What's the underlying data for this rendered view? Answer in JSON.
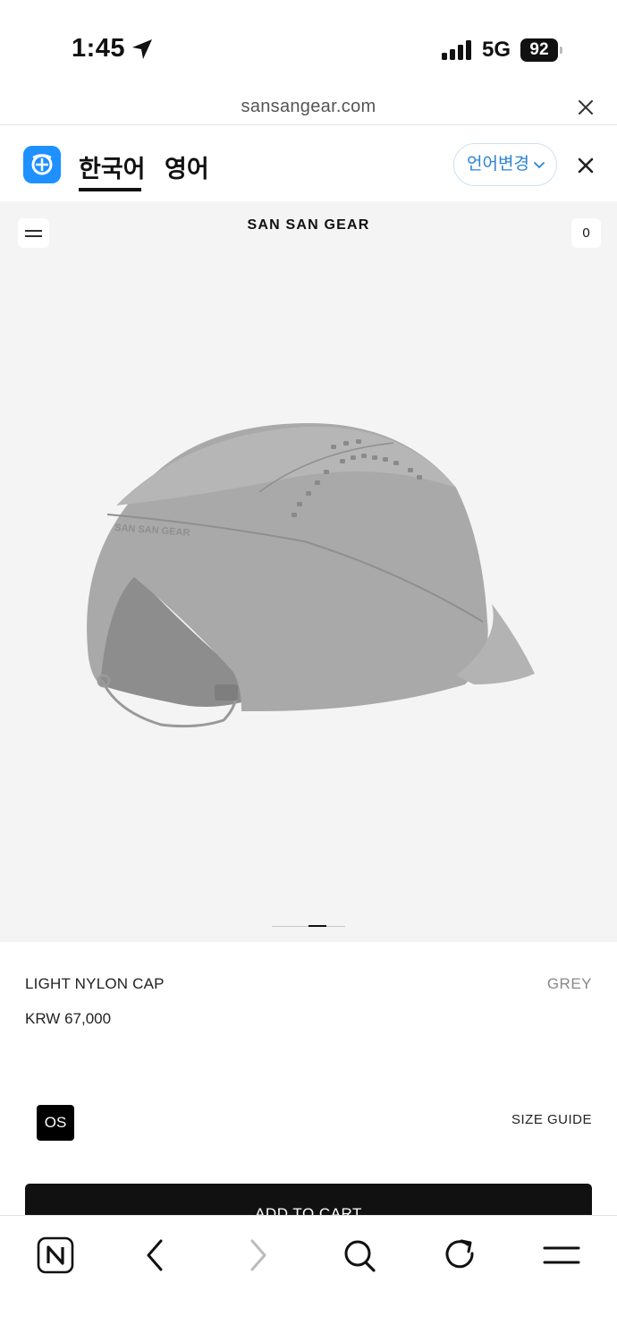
{
  "status_bar": {
    "time": "1:45",
    "network": "5G",
    "battery": "92",
    "icons": [
      "location-arrow-icon",
      "signal-bars-icon",
      "battery-icon"
    ]
  },
  "url_bar": {
    "url": "sansangear.com"
  },
  "translate_bar": {
    "tabs": [
      {
        "label": "한국어",
        "active": true
      },
      {
        "label": "영어",
        "active": false
      }
    ],
    "change_language_label": "언어변경",
    "accent": "#1e90ff"
  },
  "header": {
    "brand": "SAN SAN GEAR",
    "cart_count": "0"
  },
  "carousel": {
    "slide_count": 3,
    "active_slide": 2
  },
  "product": {
    "name": "LIGHT NYLON CAP",
    "color": "GREY",
    "price": "KRW 67,000",
    "size_options": [
      "OS"
    ],
    "selected_size": "OS",
    "size_guide_label": "SIZE GUIDE",
    "add_to_cart_label": "ADD TO CART",
    "image_logo_text": "SAN SAN GEAR"
  },
  "toolbar": {
    "icons": [
      "naver-home-icon",
      "back-icon",
      "forward-icon",
      "search-icon",
      "reload-icon",
      "menu-icon"
    ]
  }
}
